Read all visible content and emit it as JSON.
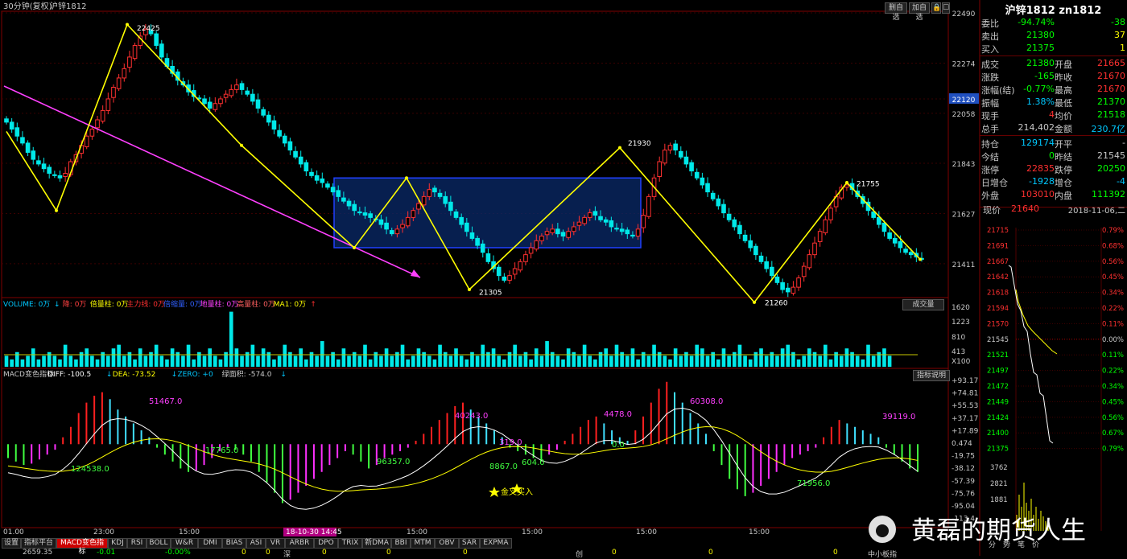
{
  "header": {
    "period": "30分钟(复权)",
    "symbol": "沪锌1812",
    "buttons": [
      "删自选",
      "加自选",
      "🔒",
      "☐"
    ]
  },
  "panel_labels": {
    "volume": [
      {
        "text": "VOLUME: 0万",
        "color": "#00c8ff"
      },
      {
        "text": "↓",
        "color": "#00c8ff"
      },
      {
        "text": "降: 0万",
        "color": "#ff4040"
      },
      {
        "text": "倍量柱: 0万",
        "color": "#ffff00"
      },
      {
        "text": "主力线: 0万",
        "color": "#ff3030"
      },
      {
        "text": "倍缩量: 0万",
        "color": "#3060ff"
      },
      {
        "text": "地量柱: 0万",
        "color": "#ff40ff"
      },
      {
        "text": "高量柱: 0万",
        "color": "#ff6060"
      },
      {
        "text": "MA1: 0万",
        "color": "#ffff00"
      },
      {
        "text": "↑",
        "color": "#ff3030"
      }
    ],
    "volume_button": "成交量",
    "macd": [
      {
        "text": "MACD变色指标 ",
        "color": "#c8c8c8"
      },
      {
        "text": "DIFF: -100.5",
        "color": "#ffffff"
      },
      {
        "text": "↓",
        "color": "#00c8ff"
      },
      {
        "text": " DEA: -73.52",
        "color": "#ffff00"
      },
      {
        "text": "↓",
        "color": "#00c8ff"
      },
      {
        "text": " ZERO: +0",
        "color": "#00c8ff"
      },
      {
        "text": " 绿面积: -574.0",
        "color": "#c8c8c8"
      },
      {
        "text": "↓",
        "color": "#00c8ff"
      }
    ],
    "macd_button": "指标说明"
  },
  "price_axis_labels": [
    "22490",
    "22274",
    "22120",
    "22058",
    "21843",
    "21627",
    "21411"
  ],
  "volume_axis_labels": [
    "1620",
    "1223",
    "810",
    "413",
    "X100"
  ],
  "macd_axis_labels": [
    "+93.17",
    "+74.81",
    "+55.53",
    "+37.17",
    "+17.89",
    "0.474",
    "-19.75",
    "-38.12",
    "-57.39",
    "-75.76",
    "-95.04",
    "-113.4"
  ],
  "time_labels": [
    "01.00",
    "23:00",
    "15:00",
    "15:00",
    "15:00",
    "15:00",
    "15:00"
  ],
  "time_cursor": "18-10-30 14:45",
  "chart_data": {
    "type": "candlestick",
    "title": "",
    "price_ylim": [
      21300,
      22490
    ],
    "current_price_marker": "22120",
    "turning_points": [
      {
        "label": "22425",
        "value": 22425
      },
      {
        "label": "21930",
        "value": 21930
      },
      {
        "label": "21305",
        "value": 21305
      },
      {
        "label": "21260",
        "value": 21260
      },
      {
        "label": "21755",
        "value": 21755
      }
    ],
    "zigzag_values": [
      21980,
      21640,
      22440,
      21920,
      21480,
      21780,
      21300,
      21910,
      21245,
      21760,
      21430
    ],
    "box_range": [
      21480,
      21780
    ],
    "closes": [
      22020,
      21990,
      21960,
      21930,
      21890,
      21860,
      21840,
      21820,
      21800,
      21790,
      21780,
      21800,
      21850,
      21880,
      21920,
      21960,
      21990,
      22030,
      22070,
      22120,
      22170,
      22210,
      22250,
      22300,
      22350,
      22390,
      22420,
      22400,
      22350,
      22300,
      22260,
      22230,
      22200,
      22180,
      22150,
      22130,
      22120,
      22100,
      22080,
      22100,
      22120,
      22140,
      22160,
      22180,
      22160,
      22140,
      22110,
      22080,
      22050,
      22020,
      21990,
      21960,
      21930,
      21900,
      21870,
      21840,
      21810,
      21790,
      21770,
      21760,
      21740,
      21720,
      21700,
      21680,
      21660,
      21640,
      21630,
      21620,
      21610,
      21600,
      21580,
      21560,
      21540,
      21560,
      21580,
      21610,
      21640,
      21670,
      21700,
      21730,
      21720,
      21700,
      21670,
      21640,
      21610,
      21580,
      21550,
      21520,
      21490,
      21460,
      21420,
      21390,
      21360,
      21340,
      21360,
      21390,
      21420,
      21450,
      21480,
      21510,
      21530,
      21550,
      21560,
      21540,
      21530,
      21550,
      21570,
      21590,
      21610,
      21630,
      21620,
      21600,
      21590,
      21570,
      21560,
      21550,
      21540,
      21530,
      21560,
      21620,
      21700,
      21780,
      21850,
      21900,
      21920,
      21900,
      21870,
      21840,
      21810,
      21780,
      21750,
      21720,
      21690,
      21660,
      21630,
      21600,
      21570,
      21540,
      21510,
      21480,
      21450,
      21420,
      21390,
      21360,
      21330,
      21300,
      21290,
      21310,
      21350,
      21400,
      21450,
      21500,
      21550,
      21600,
      21650,
      21700,
      21740,
      21750,
      21730,
      21700,
      21670,
      21640,
      21610,
      21580,
      21550,
      21520,
      21500,
      21480,
      21460,
      21450,
      21440,
      21430
    ],
    "volumes": [
      3,
      2,
      4,
      2,
      3,
      5,
      2,
      3,
      4,
      3,
      2,
      6,
      3,
      2,
      4,
      5,
      3,
      2,
      4,
      3,
      5,
      6,
      3,
      4,
      2,
      5,
      3,
      4,
      6,
      3,
      2,
      5,
      4,
      3,
      6,
      2,
      4,
      3,
      5,
      3,
      2,
      4,
      15,
      5,
      3,
      4,
      6,
      3,
      5,
      4,
      2,
      3,
      6,
      4,
      3,
      5,
      2,
      4,
      3,
      7,
      3,
      4,
      2,
      5,
      3,
      4,
      3,
      6,
      2,
      4,
      3,
      5,
      3,
      4,
      6,
      2,
      3,
      5,
      4,
      3,
      2,
      6,
      4,
      3,
      5,
      3,
      2,
      4,
      3,
      6,
      4,
      5,
      3,
      2,
      4,
      6,
      3,
      4,
      2,
      5,
      3,
      7,
      4,
      3,
      2,
      5,
      4,
      3,
      6,
      3,
      2,
      4,
      5,
      3,
      6,
      4,
      3,
      5,
      2,
      4,
      3,
      6,
      4,
      3,
      2,
      5,
      3,
      4,
      3,
      6,
      5,
      3,
      4,
      2,
      5,
      3,
      4,
      6,
      3,
      2,
      4,
      5,
      3,
      4,
      3,
      5,
      6,
      4,
      2,
      3,
      5,
      4,
      3,
      6,
      2,
      4,
      3,
      5,
      4,
      3,
      2,
      6,
      3,
      4,
      5,
      3
    ],
    "volume_ylim": [
      0,
      16
    ],
    "macd_hist": [
      -20,
      -25,
      -30,
      -28,
      -22,
      -15,
      -8,
      10,
      25,
      45,
      60,
      70,
      75,
      65,
      50,
      40,
      30,
      20,
      10,
      -5,
      -15,
      -25,
      -35,
      -40,
      -38,
      -30,
      -20,
      -10,
      -5,
      -8,
      -15,
      -25,
      -40,
      -55,
      -70,
      -85,
      -80,
      -70,
      -60,
      -50,
      -40,
      -30,
      -20,
      -10,
      -15,
      -25,
      -35,
      -30,
      -20,
      -15,
      -10,
      -5,
      5,
      15,
      25,
      35,
      45,
      55,
      60,
      50,
      40,
      30,
      20,
      10,
      -5,
      -10,
      -15,
      -20,
      -25,
      -15,
      -8,
      5,
      15,
      25,
      35,
      40,
      30,
      20,
      10,
      5,
      20,
      40,
      60,
      80,
      90,
      75,
      60,
      45,
      30,
      15,
      -10,
      -30,
      -50,
      -65,
      -75,
      -70,
      -60,
      -50,
      -40,
      -30,
      -20,
      -15,
      -10,
      -5,
      10,
      25,
      35,
      30,
      25,
      20,
      15,
      10,
      -5,
      -15,
      -25,
      -35,
      -40
    ],
    "macd_ylim": [
      -113.4,
      93.17
    ],
    "annotations": [
      "51467.0",
      "124538.0",
      "17765.0",
      "96357.0",
      "40243.0",
      "319.0",
      "8867.0",
      "604.0",
      "4478.0",
      "0.0",
      "60308.0",
      "71956.0",
      "39119.0",
      "金叉买入"
    ]
  },
  "bottom": {
    "tabs": [
      "设置",
      "指标平台",
      "MACD变色指标",
      "KDJ",
      "RSI",
      "BOLL",
      "W&R",
      "DMI",
      "BIAS",
      "ASI",
      "VR",
      "ARBR",
      "DPO",
      "TRIX",
      "新DMA",
      "BBI",
      "MTM",
      "OBV",
      "SAR",
      "EXPMA"
    ],
    "status": [
      "2659.35",
      "-0.01",
      "-0.00%",
      "0",
      "0",
      "深",
      "0",
      "0",
      "0",
      "创",
      "0",
      "0",
      "0",
      "中小板指"
    ]
  },
  "quote": {
    "title": "沪锌1812 zn1812",
    "rows1": [
      {
        "label": "委比",
        "v1": "-94.74%",
        "c1": "#00ff00",
        "v2": "-38",
        "c2": "#00ff00"
      },
      {
        "label": "卖出",
        "v1": "21380",
        "c1": "#00ff00",
        "v2": "37",
        "c2": "#ffff00"
      },
      {
        "label": "买入",
        "v1": "21375",
        "c1": "#00ff00",
        "v2": "1",
        "c2": "#ffff00"
      }
    ],
    "rows2": [
      {
        "l1": "成交",
        "v1": "21380",
        "c1": "#00ff00",
        "l2": "开盘",
        "v2": "21665",
        "c2": "#ff3030"
      },
      {
        "l1": "涨跌",
        "v1": "-165",
        "c1": "#00ff00",
        "l2": "昨收",
        "v2": "21670",
        "c2": "#ff3030"
      },
      {
        "l1": "涨幅(结)",
        "v1": "-0.77%",
        "c1": "#00ff00",
        "l2": "最高",
        "v2": "21670",
        "c2": "#ff3030"
      },
      {
        "l1": "振幅",
        "v1": "1.38%",
        "c1": "#00c8ff",
        "l2": "最低",
        "v2": "21370",
        "c2": "#00ff00"
      },
      {
        "l1": "现手",
        "v1": "4",
        "c1": "#ff3030",
        "l2": "均价",
        "v2": "21518",
        "c2": "#00ff00"
      },
      {
        "l1": "总手",
        "v1": "214,402",
        "c1": "#c8c8c8",
        "l2": "金额",
        "v2": "230.7亿",
        "c2": "#00c8ff"
      }
    ],
    "rows3": [
      {
        "l1": "持仓",
        "v1": "129174",
        "c1": "#00c8ff",
        "l2": "开平",
        "v2": "-",
        "c2": "#c8c8c8"
      },
      {
        "l1": "今结",
        "v1": "0",
        "c1": "#00ff00",
        "l2": "昨结",
        "v2": "21545",
        "c2": "#c8c8c8"
      },
      {
        "l1": "涨停",
        "v1": "22835",
        "c1": "#ff3030",
        "l2": "跌停",
        "v2": "20250",
        "c2": "#00ff00"
      },
      {
        "l1": "日增仓",
        "v1": "-1928",
        "c1": "#00c8ff",
        "l2": "增仓",
        "v2": "-4",
        "c2": "#00c8ff"
      },
      {
        "l1": "外盘",
        "v1": "103010",
        "c1": "#ff3030",
        "l2": "内盘",
        "v2": "111392",
        "c2": "#00ff00"
      }
    ],
    "now_label": "现价",
    "now_value": "21640",
    "now_date": "2018-11-06,二"
  },
  "mini_chart": {
    "price_labels": [
      "21715",
      "21691",
      "21667",
      "21642",
      "21618",
      "21594",
      "21570",
      "21545",
      "21521",
      "21497",
      "21472",
      "21449",
      "21424",
      "21400",
      "21375"
    ],
    "pct_labels": [
      "0.79%",
      "0.68%",
      "0.56%",
      "0.45%",
      "0.34%",
      "0.22%",
      "0.11%",
      "0.00%",
      "0.11%",
      "0.22%",
      "0.34%",
      "0.45%",
      "0.56%",
      "0.67%",
      "0.79%"
    ],
    "vol_labels": [
      "3762",
      "2821",
      "1881"
    ],
    "bottom_tabs": [
      "分",
      "势",
      "笔",
      "价"
    ]
  },
  "watermark": "黄磊的期货人生"
}
